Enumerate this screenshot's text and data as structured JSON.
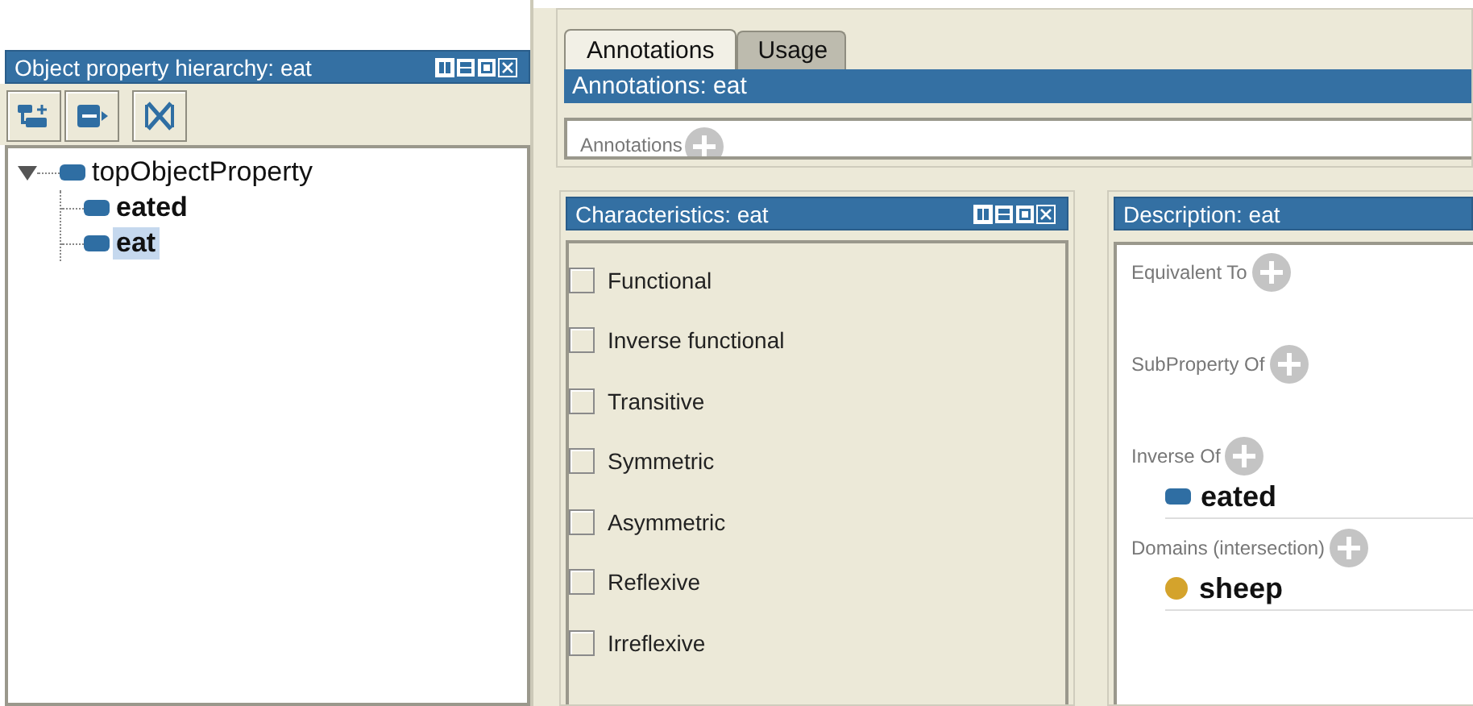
{
  "hierarchy": {
    "title": "Object property hierarchy: eat",
    "tree": [
      {
        "label": "topObjectProperty",
        "expanded": true,
        "selected": false,
        "children": [
          {
            "label": "eated",
            "selected": false
          },
          {
            "label": "eat",
            "selected": true
          }
        ]
      }
    ]
  },
  "tabs": [
    {
      "label": "Annotations",
      "selected": true
    },
    {
      "label": "Usage",
      "selected": false
    }
  ],
  "annotations": {
    "title": "Annotations: eat",
    "section": "Annotations"
  },
  "characteristics": {
    "title": "Characteristics: eat",
    "items": [
      {
        "label": "Functional",
        "checked": false
      },
      {
        "label": "Inverse functional",
        "checked": false
      },
      {
        "label": "Transitive",
        "checked": false
      },
      {
        "label": "Symmetric",
        "checked": false
      },
      {
        "label": "Asymmetric",
        "checked": false
      },
      {
        "label": "Reflexive",
        "checked": false
      },
      {
        "label": "Irreflexive",
        "checked": false
      }
    ]
  },
  "description": {
    "title": "Description: eat",
    "sections": [
      {
        "label": "Equivalent To"
      },
      {
        "label": "SubProperty Of"
      },
      {
        "label": "Inverse Of",
        "entries": [
          {
            "label": "eated",
            "kind": "property"
          }
        ]
      },
      {
        "label": "Domains (intersection)",
        "entries": [
          {
            "label": "sheep",
            "kind": "class"
          }
        ]
      }
    ]
  }
}
